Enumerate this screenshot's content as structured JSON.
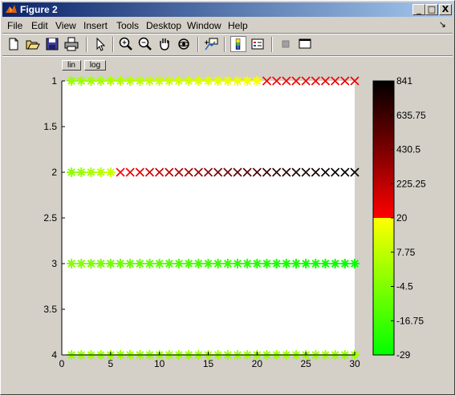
{
  "window": {
    "title": "Figure 2"
  },
  "caption_buttons": {
    "minimize": "_",
    "maximize": "□",
    "close": "X"
  },
  "menu": [
    "File",
    "Edit",
    "View",
    "Insert",
    "Tools",
    "Desktop",
    "Window",
    "Help"
  ],
  "menu_arrow": "↘",
  "toolbar_icons": [
    "new-figure-icon",
    "open-file-icon",
    "save-icon",
    "print-icon",
    "select-arrow-icon",
    "zoom-in-icon",
    "zoom-out-icon",
    "pan-hand-icon",
    "rotate-3d-icon",
    "data-cursor-icon",
    "colorbar-icon",
    "legend-icon",
    "hide-plot-tools-icon",
    "show-plot-tools-icon"
  ],
  "scale_buttons": {
    "lin": "lin",
    "log": "log"
  },
  "chart_data": {
    "type": "scatter",
    "xlim": [
      0,
      30
    ],
    "ylim": [
      1,
      4
    ],
    "y_reversed": true,
    "xticks": [
      "0",
      "5",
      "10",
      "15",
      "20",
      "25",
      "30"
    ],
    "yticks": [
      "1",
      "1.5",
      "2",
      "2.5",
      "3",
      "3.5",
      "4"
    ],
    "colorbar": {
      "ticks": [
        "841",
        "635.75",
        "430.5",
        "225.25",
        "20",
        "7.75",
        "-4.5",
        "-16.75",
        "-29"
      ],
      "split_value": 20
    },
    "series": [
      {
        "y": 1,
        "x_start": 1,
        "x_end": 30,
        "marker_star_until": 20,
        "values": [
          0,
          1,
          2,
          3,
          4,
          5,
          6,
          7,
          8,
          9,
          10,
          11,
          12,
          13,
          14,
          15,
          16,
          17,
          18,
          19,
          30,
          35,
          40,
          45,
          50,
          55,
          60,
          65,
          70,
          75
        ]
      },
      {
        "y": 2,
        "x_start": 1,
        "x_end": 30,
        "marker_star_until": 5,
        "values": [
          -2,
          0,
          3,
          6,
          9,
          40,
          80,
          120,
          160,
          200,
          240,
          280,
          320,
          360,
          400,
          440,
          480,
          520,
          560,
          600,
          640,
          680,
          710,
          740,
          770,
          790,
          810,
          825,
          835,
          841
        ]
      },
      {
        "y": 3,
        "x_start": 1,
        "x_end": 30,
        "marker_star_until": 30,
        "values": [
          -3,
          -4,
          -5,
          -6,
          -7,
          -8,
          -9,
          -10,
          -11,
          -12,
          -13,
          -14,
          -15,
          -16,
          -17,
          -18,
          -19,
          -20,
          -21,
          -22,
          -23,
          -24,
          -25,
          -25,
          -26,
          -26,
          -27,
          -27,
          -28,
          -29
        ]
      },
      {
        "y": 4,
        "x_start": 1,
        "x_end": 30,
        "marker_star_until": 30,
        "values": [
          -1,
          0,
          1,
          0,
          -1,
          0,
          1,
          0,
          -1,
          0,
          1,
          0,
          -1,
          0,
          1,
          0,
          -1,
          0,
          1,
          0,
          -1,
          0,
          1,
          0,
          -1,
          0,
          1,
          0,
          -1,
          0
        ]
      }
    ]
  }
}
